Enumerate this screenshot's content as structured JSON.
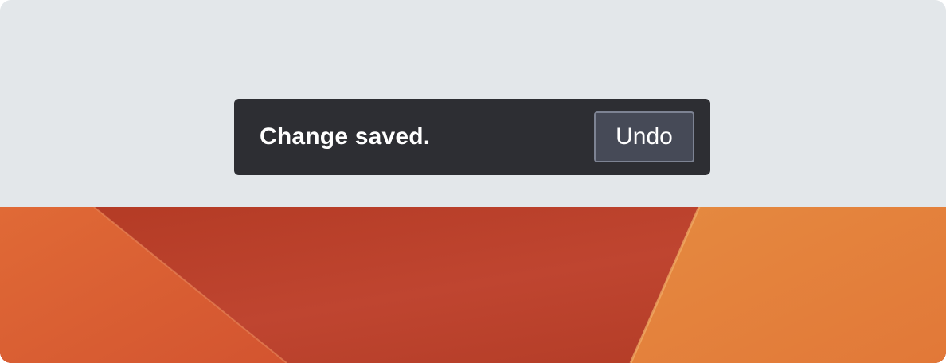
{
  "toast": {
    "message": "Change saved.",
    "undo_label": "Undo"
  },
  "colors": {
    "panel_background": "#e3e7ea",
    "toast_background": "#2d2e33",
    "button_background": "#464a57",
    "button_border": "#7d8393",
    "text": "#ffffff",
    "wallpaper_red": "#c24a2a",
    "wallpaper_orange": "#e07a38"
  }
}
